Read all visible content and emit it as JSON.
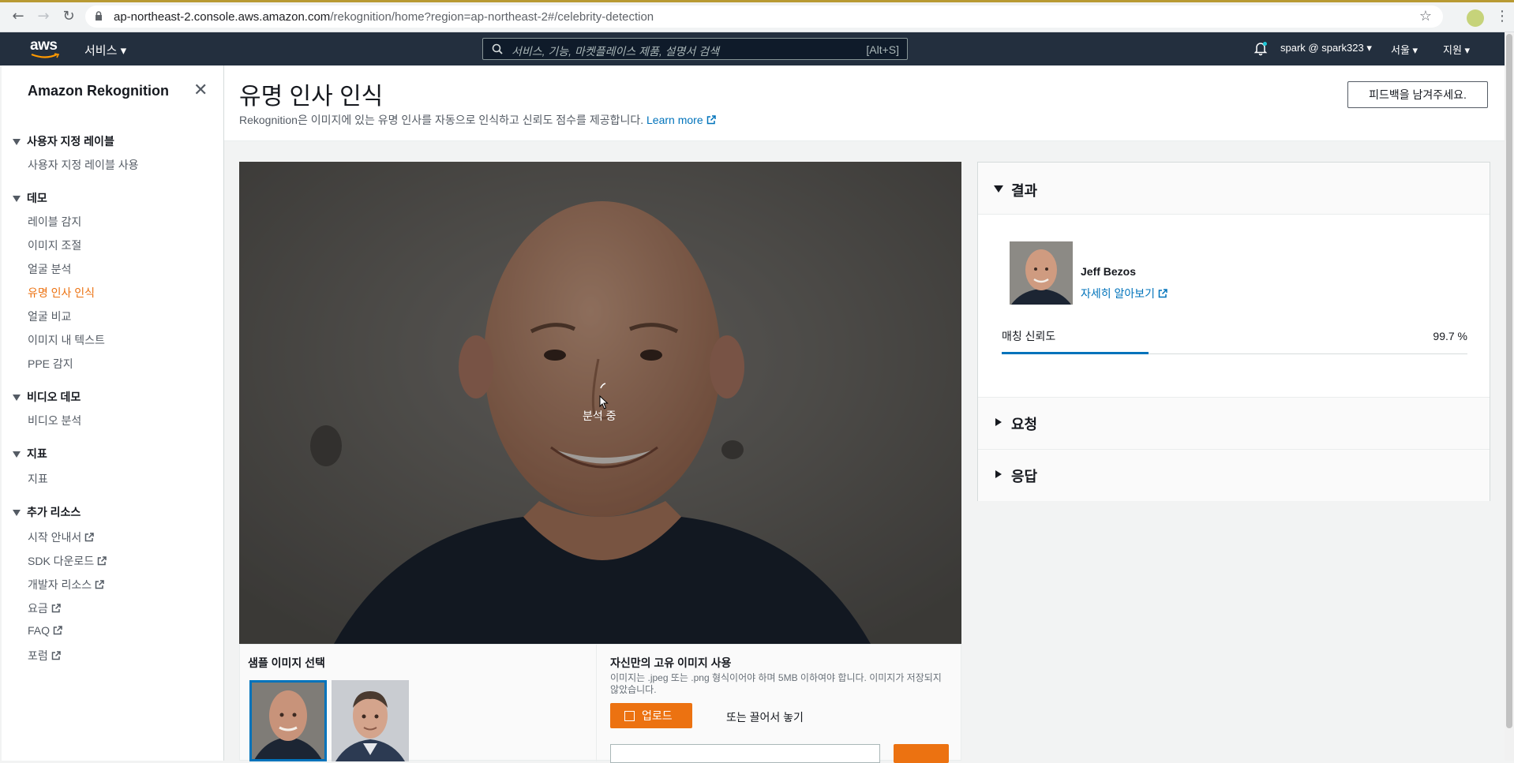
{
  "browser": {
    "url_host": "ap-northeast-2.console.aws.amazon.com",
    "url_path": "/rekognition/home?region=ap-northeast-2#/celebrity-detection"
  },
  "awsnav": {
    "logo": "aws",
    "services": "서비스",
    "search_placeholder": "서비스, 기능, 마켓플레이스 제품, 설명서 검색",
    "search_shortcut": "[Alt+S]",
    "account": "spark @ spark323",
    "region": "서울",
    "support": "지원"
  },
  "sidebar": {
    "title": "Amazon Rekognition",
    "sections": [
      {
        "label": "사용자 지정 레이블",
        "items": [
          "사용자 지정 레이블 사용"
        ]
      },
      {
        "label": "데모",
        "items": [
          "레이블 감지",
          "이미지 조절",
          "얼굴 분석",
          "유명 인사 인식",
          "얼굴 비교",
          "이미지 내 텍스트",
          "PPE 감지"
        ]
      },
      {
        "label": "비디오 데모",
        "items": [
          "비디오 분석"
        ]
      },
      {
        "label": "지표",
        "items": [
          "지표"
        ]
      },
      {
        "label": "추가 리소스",
        "items": [
          "시작 안내서",
          "SDK 다운로드",
          "개발자 리소스",
          "요금",
          "FAQ",
          "포럼"
        ]
      }
    ]
  },
  "header": {
    "title": "유명 인사 인식",
    "description": "Rekognition은 이미지에 있는 유명 인사를 자동으로 인식하고 신뢰도 점수를 제공합니다.",
    "learn_more": "Learn more",
    "feedback_button": "피드백을 남겨주세요."
  },
  "image_panel": {
    "status": "분석 중"
  },
  "bottom": {
    "sample_title": "샘플 이미지 선택",
    "own_title": "자신만의 고유 이미지 사용",
    "own_desc": "이미지는 .jpeg 또는 .png 형식이어야 하며 5MB 이하여야 합니다. 이미지가 저장되지 않았습니다.",
    "upload_button": "업로드",
    "drag_text": "또는 끌어서 놓기"
  },
  "results": {
    "title": "결과",
    "celebrity_name": "Jeff Bezos",
    "learn_more": "자세히 알아보기",
    "confidence_label": "매칭 신뢰도",
    "confidence_value": "99.7 %",
    "request_title": "요청",
    "response_title": "응답"
  },
  "colors": {
    "aws_nav": "#232f3e",
    "accent_orange": "#ec7211",
    "link_blue": "#0073bb"
  }
}
